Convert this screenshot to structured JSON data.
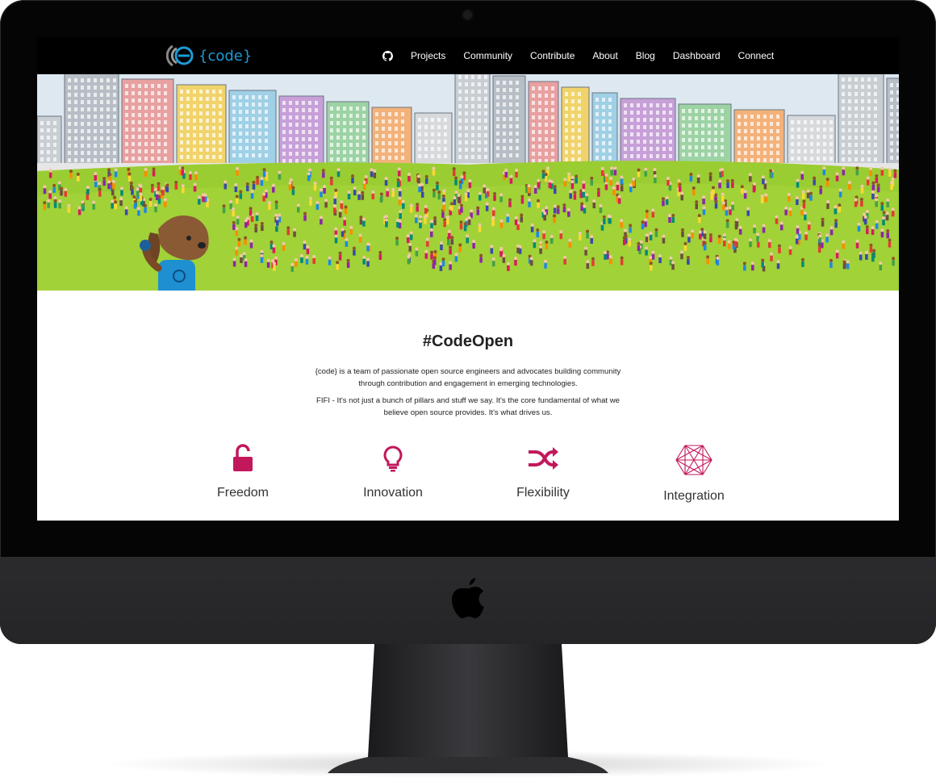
{
  "header": {
    "brand": "{code}",
    "nav": [
      "Projects",
      "Community",
      "Contribute",
      "About",
      "Blog",
      "Dashboard",
      "Connect"
    ]
  },
  "main": {
    "title": "#CodeOpen",
    "paragraphs": [
      "{code} is a team of passionate open source engineers and advocates building community through contribution and engagement in emerging technologies.",
      "FIFI - It's not just a bunch of pillars and stuff we say. It's the core fundamental of what we believe open source provides. It's what drives us."
    ],
    "pillars": [
      {
        "label": "Freedom",
        "icon": "unlock-icon"
      },
      {
        "label": "Innovation",
        "icon": "lightbulb-icon"
      },
      {
        "label": "Flexibility",
        "icon": "shuffle-icon"
      },
      {
        "label": "Integration",
        "icon": "hexagon-network-icon"
      }
    ]
  },
  "colors": {
    "accent": "#c2185b",
    "brand_blue": "#1e9bd7",
    "grass": "#9acd32",
    "sky": "#dde8f1"
  }
}
